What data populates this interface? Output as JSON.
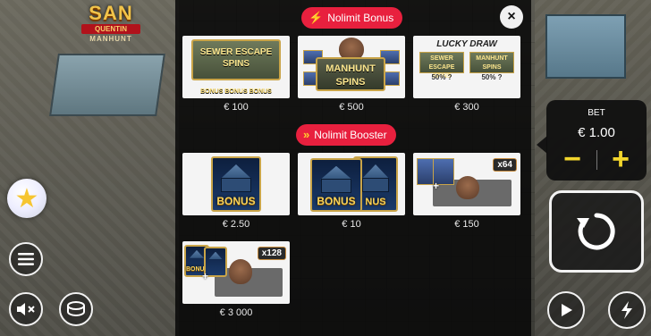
{
  "logo": {
    "main": "SAN",
    "band": "QUENTIN",
    "sub": "MANHUNT"
  },
  "modal": {
    "close_label": "×",
    "sections": [
      {
        "title": "Nolimit Bonus",
        "icon": "lightning-icon",
        "items": [
          {
            "art_text": [
              "SEWER ESCAPE",
              "SPINS"
            ],
            "subtext": "BONUS BONUS BONUS",
            "price": "€ 100"
          },
          {
            "art_text": [
              "MANHUNT",
              "SPINS"
            ],
            "price": "€ 500"
          },
          {
            "art_title": "LUCKY DRAW",
            "left": [
              "SEWER ESCAPE",
              "SPINS",
              "50% ?"
            ],
            "right": [
              "MANHUNT",
              "SPINS",
              "50% ?"
            ],
            "price": "€ 300"
          }
        ]
      },
      {
        "title": "Nolimit Booster",
        "icon": "double-chevron-icon",
        "items": [
          {
            "art_label": "BONUS",
            "price": "€ 2.50"
          },
          {
            "art_label": "BONUS",
            "art_label_2": "NUS",
            "price": "€ 10"
          },
          {
            "multiplier": "x64",
            "price": "€ 150"
          },
          {
            "art_label": "BONUS",
            "multiplier": "x128",
            "price": "€ 3 000"
          }
        ]
      }
    ]
  },
  "bet": {
    "label": "BET",
    "value": "€ 1.00",
    "minus": "−",
    "plus": "+"
  },
  "colors": {
    "pill": "#e8203e",
    "accent_yellow": "#f2d52c",
    "gold": "#c9a448"
  }
}
